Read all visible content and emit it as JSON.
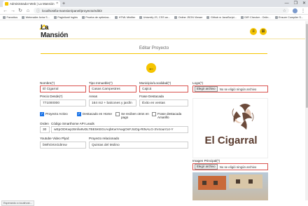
{
  "browser": {
    "tab": {
      "title": "Administrador Web | La Mansión"
    },
    "window_controls": {
      "minimize": "—",
      "maximize": "❐",
      "close": "✕"
    },
    "url": "localhost/la-mansion/panel/proyecto/edit/2",
    "bookmarks": [
      {
        "label": "Favoritos"
      },
      {
        "label": "Webmailer Avira S..."
      },
      {
        "label": "Paginlizati Inglés"
      },
      {
        "label": "Prueba de optimiza..."
      },
      {
        "label": "HTML Minifier"
      },
      {
        "label": "Unicmify JS, CSS an..."
      },
      {
        "label": "Online JSON Viewer"
      },
      {
        "label": "Github w JavaScript..."
      },
      {
        "label": "DIR Checker - Onlin..."
      },
      {
        "label": "Ensure Compiler S..."
      }
    ],
    "status_text": "Esperando a localhost..."
  },
  "header": {
    "logo_text": "La Mansión",
    "menu_icon": "≡",
    "grid_icon": "⊞"
  },
  "page": {
    "title": "Editar Proyecto",
    "back_icon": "←"
  },
  "form": {
    "nombre": {
      "label": "Nombre(*)",
      "value": "El Cigarral"
    },
    "tipo_inmueble": {
      "label": "Tipo Inmueble(*)",
      "value": "Casas Campestres"
    },
    "municipio": {
      "label": "Municipio/Localidad(*)",
      "value": "Cajicá"
    },
    "logo": {
      "label": "Logo(*)",
      "button": "Elegir archivo",
      "status": "No se eligió ningún archivo"
    },
    "precio": {
      "label": "Precio Desde(*)",
      "value": "771000000"
    },
    "areas": {
      "label": "Areas",
      "value": "164 m2 + balcones y jardín"
    },
    "frase_destacada": {
      "label": "Frase Destacada",
      "value": "Éxito en ventas"
    },
    "checkboxes": [
      {
        "label": "Proyecto Activo",
        "checked": true
      },
      {
        "label": "Destacado en Home",
        "checked": true
      },
      {
        "label": "Se reciben otros en pago",
        "checked": false
      },
      {
        "label": "Frase destacada Amarillo",
        "checked": false
      }
    ],
    "orden": {
      "label": "Orden",
      "value": "30"
    },
    "codigo_smarthome": {
      "label": "Código Smarthome API Leads",
      "value": "wEpODKwp3tmfw8vDLTBE5KEGcAqbKwYAwgOsFJUDg-RtNALG-3V4ourr14-Y"
    },
    "imagen_principal": {
      "label": "Imagen Principal(*)",
      "button": "Elegir archivo",
      "status": "No se eligió ningún archivo"
    },
    "youtube": {
      "label": "Youtube Video Plyal:",
      "value": "bWhGKnGdImw"
    },
    "proyecto_relacionado": {
      "label": "Proyecto relacionado",
      "value": "Quintas del Molino"
    }
  },
  "logo_preview": {
    "brand_text": "El Cigarral"
  },
  "colors": {
    "accent": "#f5c400",
    "invalid_border": "#d9534f",
    "check_blue": "#1a73e8"
  }
}
